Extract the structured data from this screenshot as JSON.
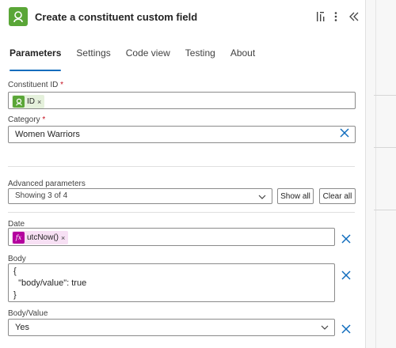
{
  "header": {
    "title": "Create a constituent custom field",
    "app_color": "#5aa637"
  },
  "tabs": [
    {
      "label": "Parameters",
      "active": true
    },
    {
      "label": "Settings"
    },
    {
      "label": "Code view"
    },
    {
      "label": "Testing"
    },
    {
      "label": "About"
    }
  ],
  "constituent_id": {
    "label": "Constituent ID",
    "required_mark": "*",
    "token_label": "ID",
    "token_close": "×",
    "token_color": "#5aa637"
  },
  "category": {
    "label": "Category",
    "required_mark": "*",
    "value": "Women Warriors"
  },
  "advanced": {
    "label": "Advanced parameters",
    "value": "Showing 3 of 4",
    "show_all": "Show all",
    "clear_all": "Clear all"
  },
  "date": {
    "label": "Date",
    "token_label": "utcNow()",
    "token_close": "×",
    "token_color": "#b4009e",
    "token_icon_text": "fx"
  },
  "body": {
    "label": "Body",
    "line1": "{",
    "line2": "  \"body/value\": true",
    "line3": "}"
  },
  "body_value": {
    "label": "Body/Value",
    "value": "Yes"
  },
  "accent_color": "#0f6cbd"
}
